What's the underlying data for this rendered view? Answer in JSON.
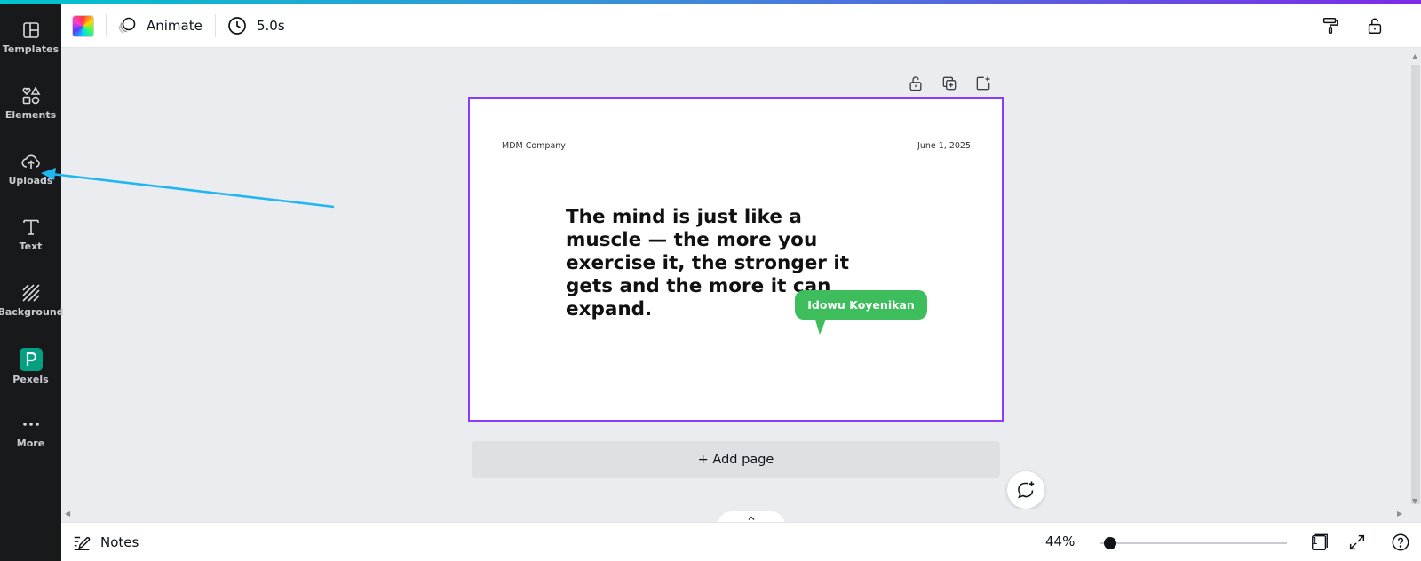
{
  "sidebar": {
    "items": [
      {
        "label": "Templates",
        "icon": "templates-icon"
      },
      {
        "label": "Elements",
        "icon": "elements-icon"
      },
      {
        "label": "Uploads",
        "icon": "upload-cloud-icon"
      },
      {
        "label": "Text",
        "icon": "text-icon"
      },
      {
        "label": "Background",
        "icon": "background-icon"
      },
      {
        "label": "Pexels",
        "icon": "pexels-icon"
      },
      {
        "label": "More",
        "icon": "more-icon"
      }
    ]
  },
  "toolbar": {
    "animate_label": "Animate",
    "duration_label": "5.0s"
  },
  "design": {
    "company": "MDM Company",
    "date": "June 1, 2025",
    "quote": "The mind is just like a muscle — the more you exercise it, the stronger it gets and the more it can expand.",
    "comment_author": "Idowu Koyenikan"
  },
  "canvas": {
    "add_page_label": "+ Add page"
  },
  "bottom_bar": {
    "notes_label": "Notes",
    "zoom_value": "44%",
    "zoom_level_fraction": 0.05,
    "page_count": "1"
  },
  "colors": {
    "accent": "#8b3dff",
    "sidebar_bg": "#18191b",
    "bubble": "#3dbd5c",
    "annotation_arrow": "#1fb6f2"
  }
}
